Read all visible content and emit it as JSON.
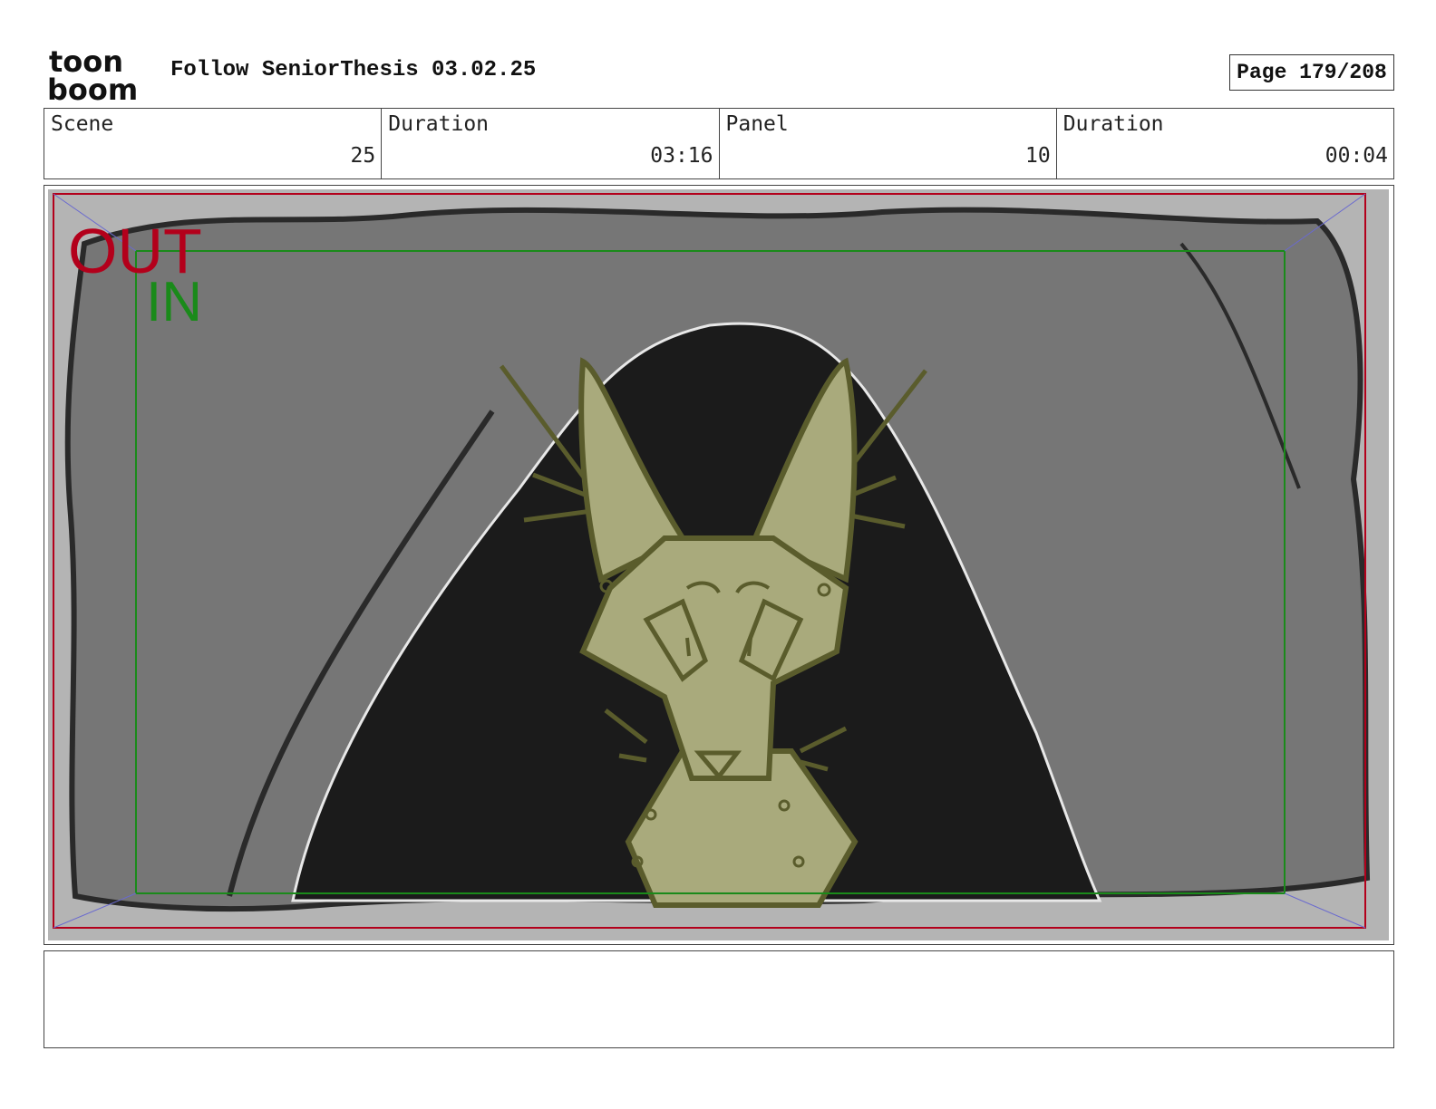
{
  "header": {
    "logo_top": "toon",
    "logo_bottom": "boom",
    "title": "Follow SeniorThesis 03.02.25",
    "page_label": "Page 179/208"
  },
  "info": [
    {
      "label": "Scene",
      "value": "25"
    },
    {
      "label": "Duration",
      "value": "03:16"
    },
    {
      "label": "Panel",
      "value": "10"
    },
    {
      "label": "Duration",
      "value": "00:04"
    }
  ],
  "panel": {
    "out_label": "OUT",
    "in_label": "IN",
    "colors": {
      "out_frame": "#b3001b",
      "in_frame": "#1a8a1a",
      "cave_wall": "#767676",
      "cave_edge": "#b4b4b4",
      "cave_opening": "#1b1b1b",
      "fox_fill": "#a9aa7c",
      "fox_line": "#5a5c2c"
    },
    "subject_icon": "fox-character"
  },
  "notes": {
    "text": ""
  }
}
